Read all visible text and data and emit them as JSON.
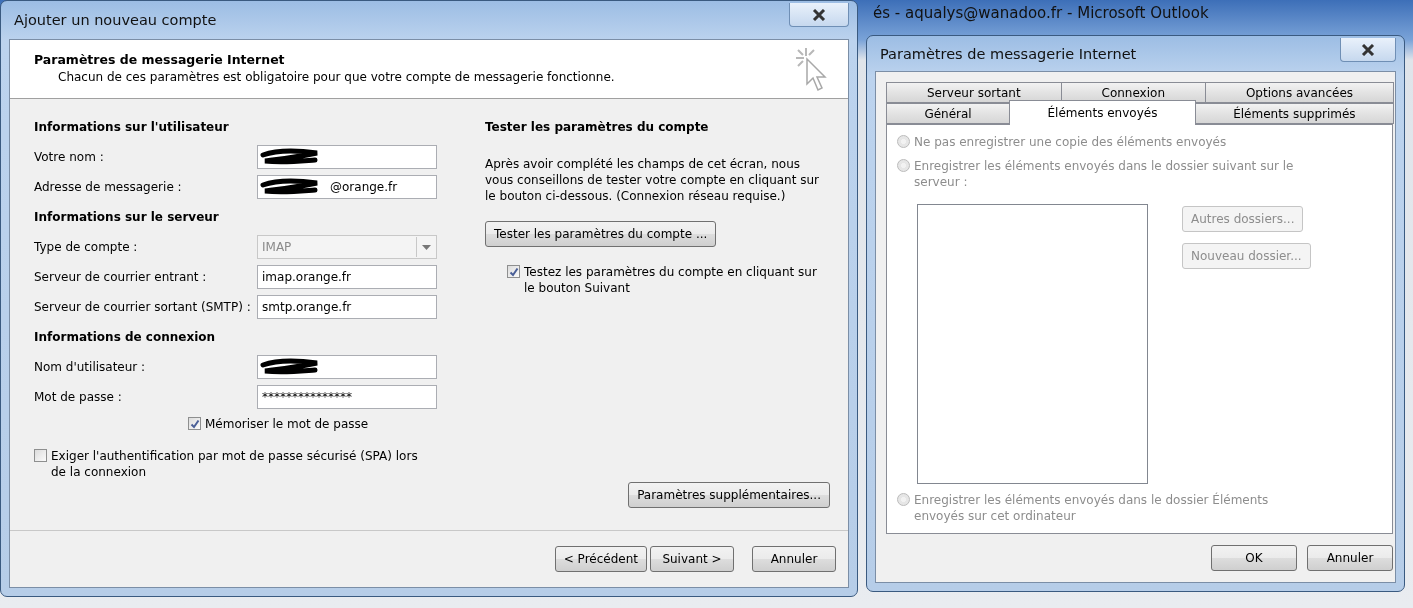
{
  "background_window": {
    "title": "és - aqualys@wanadoo.fr - Microsoft Outlook"
  },
  "account_dialog": {
    "title": "Ajouter un nouveau compte",
    "heading": "Paramètres de messagerie Internet",
    "subheading": "Chacun de ces paramètres est obligatoire pour que votre compte de messagerie fonctionne.",
    "sections": [
      {
        "title": "Informations sur l'utilisateur",
        "fields": [
          {
            "label": "Votre nom :",
            "kind": "text",
            "redacted": true
          },
          {
            "label": "Adresse de messagerie :",
            "kind": "text",
            "value": "@orange.fr",
            "redacted": true
          }
        ]
      },
      {
        "title": "Informations sur le serveur",
        "fields": [
          {
            "label": "Type de compte :",
            "kind": "select",
            "value": "IMAP",
            "disabled": true
          },
          {
            "label": "Serveur de courrier entrant :",
            "kind": "text",
            "value": "imap.orange.fr"
          },
          {
            "label": "Serveur de courrier sortant (SMTP) :",
            "kind": "text",
            "value": "smtp.orange.fr"
          }
        ]
      },
      {
        "title": "Informations de connexion",
        "fields": [
          {
            "label": "Nom d'utilisateur :",
            "kind": "text",
            "redacted": true
          },
          {
            "label": "Mot de passe :",
            "kind": "text",
            "value": "***************"
          }
        ]
      }
    ],
    "remember_password": {
      "label": "Mémoriser le mot de passe",
      "checked": true
    },
    "spa": {
      "label": "Exiger l'authentification par mot de passe sécurisé (SPA) lors de la connexion",
      "checked": false
    },
    "test": {
      "title": "Tester les paramètres du compte",
      "description": "Après avoir complété les champs de cet écran, nous vous conseillons de tester votre compte en cliquant sur le bouton ci-dessous. (Connexion réseau requise.)",
      "button": "Tester les paramètres du compte ...",
      "checkbox": {
        "label": "Testez les paramètres du compte en cliquant sur le bouton Suivant",
        "checked": true
      }
    },
    "more_settings_button": "Paramètres supplémentaires...",
    "buttons": [
      "< Précédent",
      "Suivant >",
      "Annuler"
    ]
  },
  "settings_dialog": {
    "title": "Paramètres de messagerie Internet",
    "tab_rows": [
      [
        {
          "label": "Serveur sortant",
          "selected": false
        },
        {
          "label": "Connexion",
          "selected": false
        },
        {
          "label": "Options avancées",
          "selected": false
        }
      ],
      [
        {
          "label": "Général",
          "selected": false
        },
        {
          "label": "Éléments envoyés",
          "selected": true
        },
        {
          "label": "Éléments supprimés",
          "selected": false
        }
      ]
    ],
    "options": [
      {
        "label": "Ne pas enregistrer une copie des éléments envoyés",
        "selected": false,
        "disabled": true
      },
      {
        "label": "Enregistrer les éléments envoyés dans le dossier suivant sur le serveur :",
        "selected": false,
        "disabled": true
      },
      {
        "label": "Enregistrer les éléments envoyés dans le dossier Éléments envoyés sur cet ordinateur",
        "selected": false,
        "disabled": true
      }
    ],
    "folder_buttons": [
      {
        "label": "Autres dossiers...",
        "disabled": true
      },
      {
        "label": "Nouveau dossier...",
        "disabled": true
      }
    ],
    "buttons": [
      "OK",
      "Annuler"
    ]
  }
}
